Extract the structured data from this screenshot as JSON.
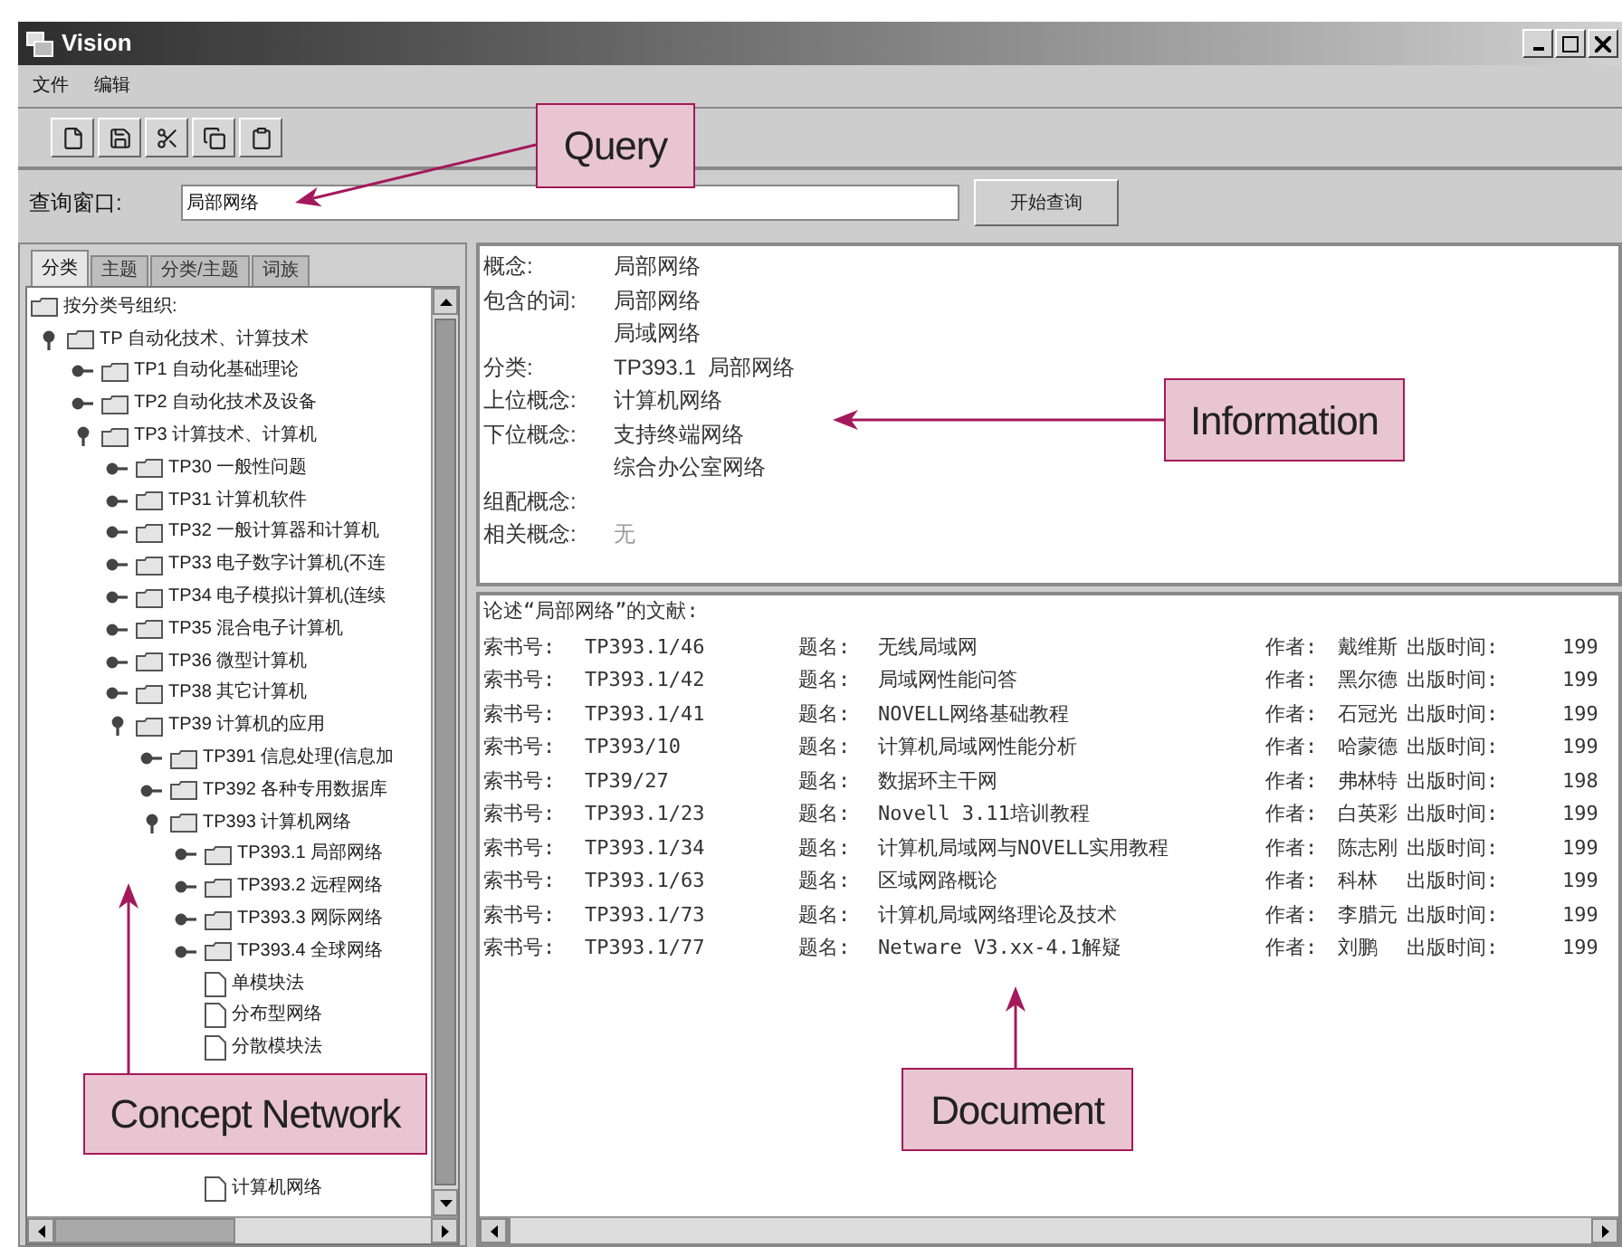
{
  "window": {
    "title": "Vision"
  },
  "menu": [
    "文件",
    "编辑"
  ],
  "query": {
    "label": "查询窗口:",
    "value": "局部网络",
    "button": "开始查询"
  },
  "tabs": [
    {
      "label": "分类",
      "selected": true
    },
    {
      "label": "主题",
      "selected": false
    },
    {
      "label": "分类/主题",
      "selected": false
    },
    {
      "label": "词族",
      "selected": false
    }
  ],
  "tree": {
    "root_label": "按分类号组织:",
    "nodes": [
      {
        "label": "TP 自动化技术、计算技术",
        "kind": "folder",
        "expanded": true,
        "children": [
          {
            "label": "TP1 自动化基础理论",
            "kind": "folder",
            "expanded": false
          },
          {
            "label": "TP2 自动化技术及设备",
            "kind": "folder",
            "expanded": false
          },
          {
            "label": "TP3 计算技术、计算机",
            "kind": "folder",
            "expanded": true,
            "children": [
              {
                "label": "TP30 一般性问题",
                "kind": "folder",
                "expanded": false
              },
              {
                "label": "TP31 计算机软件",
                "kind": "folder",
                "expanded": false
              },
              {
                "label": "TP32 一般计算器和计算机",
                "kind": "folder",
                "expanded": false
              },
              {
                "label": "TP33 电子数字计算机(不连",
                "kind": "folder",
                "expanded": false
              },
              {
                "label": "TP34 电子模拟计算机(连续",
                "kind": "folder",
                "expanded": false
              },
              {
                "label": "TP35 混合电子计算机",
                "kind": "folder",
                "expanded": false
              },
              {
                "label": "TP36 微型计算机",
                "kind": "folder",
                "expanded": false
              },
              {
                "label": "TP38 其它计算机",
                "kind": "folder",
                "expanded": false
              },
              {
                "label": "TP39 计算机的应用",
                "kind": "folder",
                "expanded": true,
                "children": [
                  {
                    "label": "TP391 信息处理(信息加",
                    "kind": "folder",
                    "expanded": false
                  },
                  {
                    "label": "TP392 各种专用数据库",
                    "kind": "folder",
                    "expanded": false
                  },
                  {
                    "label": "TP393 计算机网络",
                    "kind": "folder",
                    "expanded": true,
                    "children": [
                      {
                        "label": "TP393.1 局部网络",
                        "kind": "folder",
                        "expanded": false
                      },
                      {
                        "label": "TP393.2 远程网络",
                        "kind": "folder",
                        "expanded": false
                      },
                      {
                        "label": "TP393.3 网际网络",
                        "kind": "folder",
                        "expanded": false
                      },
                      {
                        "label": "TP393.4 全球网络",
                        "kind": "folder",
                        "expanded": false
                      },
                      {
                        "label": "单模块法",
                        "kind": "leaf"
                      },
                      {
                        "label": "分布型网络",
                        "kind": "leaf"
                      },
                      {
                        "label": "分散模块法",
                        "kind": "leaf"
                      },
                      {
                        "label": "计算机网络",
                        "kind": "leaf"
                      }
                    ]
                  }
                ]
              }
            ]
          }
        ]
      }
    ]
  },
  "information": {
    "fields": [
      {
        "label": "概念:",
        "values": [
          "局部网络"
        ]
      },
      {
        "label": "包含的词:",
        "values": [
          "局部网络",
          "局域网络"
        ]
      },
      {
        "label": "分类:",
        "values": [
          "TP393.1  局部网络"
        ]
      },
      {
        "label": "上位概念:",
        "values": [
          "计算机网络"
        ]
      },
      {
        "label": "下位概念:",
        "values": [
          "支持终端网络",
          "综合办公室网络"
        ]
      },
      {
        "label": "组配概念:"
      },
      {
        "label": "相关概念:",
        "values": [
          "无"
        ],
        "dim": true
      }
    ]
  },
  "documents": {
    "heading": "论述“局部网络”的文献:",
    "rows": [
      {
        "cells": [
          "索书号:",
          "TP393.1/46",
          "题名:",
          "无线局域网",
          "作者:",
          "戴维斯",
          "出版时间:",
          "199"
        ]
      },
      {
        "cells": [
          "索书号:",
          "TP393.1/42",
          "题名:",
          "局域网性能问答",
          "作者:",
          "黑尔德",
          "出版时间:",
          "199"
        ]
      },
      {
        "cells": [
          "索书号:",
          "TP393.1/41",
          "题名:",
          "NOVELL网络基础教程",
          "作者:",
          "石冠光",
          "出版时间:",
          "199"
        ]
      },
      {
        "cells": [
          "索书号:",
          "TP393/10",
          "题名:",
          "计算机局域网性能分析",
          "作者:",
          "哈蒙德",
          "出版时间:",
          "199"
        ]
      },
      {
        "cells": [
          "索书号:",
          "TP39/27",
          "题名:",
          "数据环主干网",
          "作者:",
          "弗林特",
          "出版时间:",
          "198"
        ]
      },
      {
        "cells": [
          "索书号:",
          "TP393.1/23",
          "题名:",
          "Novell 3.11培训教程",
          "作者:",
          "白英彩",
          "出版时间:",
          "199"
        ]
      },
      {
        "cells": [
          "索书号:",
          "TP393.1/34",
          "题名:",
          "计算机局域网与NOVELL实用教程",
          "作者:",
          "陈志刚",
          "出版时间:",
          "199"
        ]
      },
      {
        "cells": [
          "索书号:",
          "TP393.1/63",
          "题名:",
          "区域网路概论",
          "作者:",
          "科林",
          "出版时间:",
          "199"
        ]
      },
      {
        "cells": [
          "索书号:",
          "TP393.1/73",
          "题名:",
          "计算机局域网络理论及技术",
          "作者:",
          "李腊元",
          "出版时间:",
          "199"
        ]
      },
      {
        "cells": [
          "索书号:",
          "TP393.1/77",
          "题名:",
          "Netware V3.xx-4.1解疑",
          "作者:",
          "刘鹏",
          "出版时间:",
          "199"
        ]
      }
    ]
  },
  "callouts": [
    {
      "label": "Query",
      "kind": "query"
    },
    {
      "label": "Information",
      "kind": "information"
    },
    {
      "label": "Concept Network",
      "kind": "concept"
    },
    {
      "label": "Document",
      "kind": "document"
    }
  ]
}
